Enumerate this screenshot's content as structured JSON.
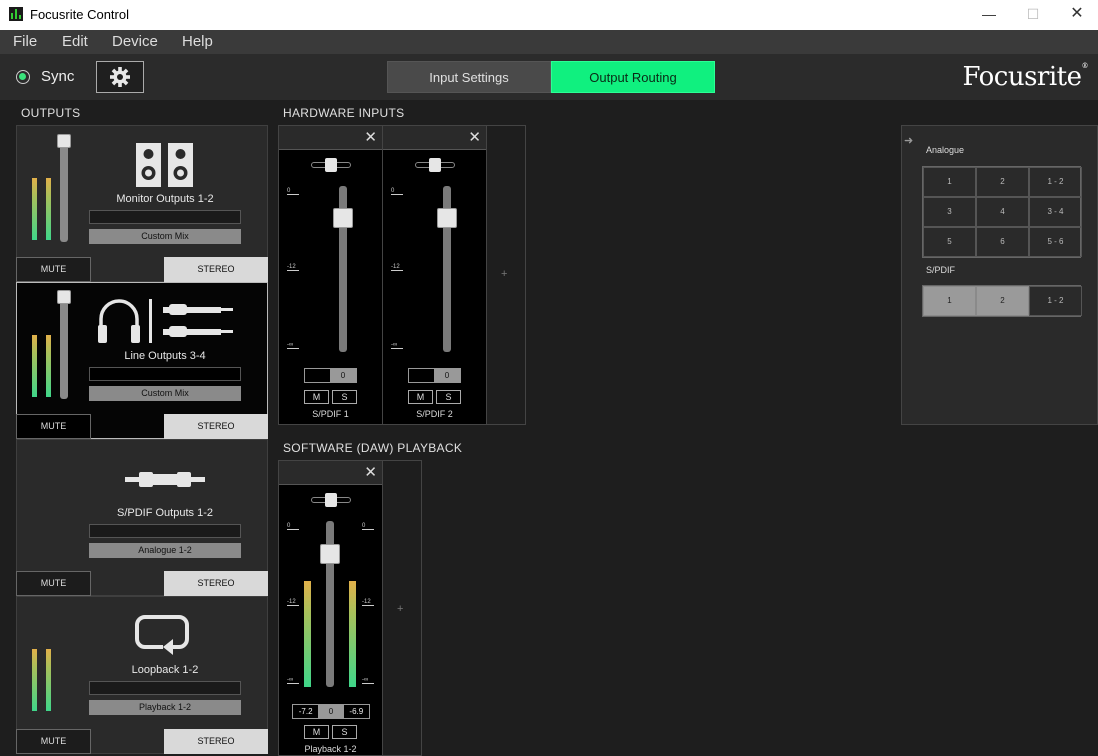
{
  "window": {
    "title": "Focusrite Control",
    "minimize": "—",
    "maximize": "☐",
    "close": "✕"
  },
  "menu": {
    "file": "File",
    "edit": "Edit",
    "device": "Device",
    "help": "Help"
  },
  "toolbar": {
    "sync_label": "Sync",
    "settings_icon": "gear-icon",
    "tab_input": "Input Settings",
    "tab_output": "Output Routing",
    "brand": "Focusrite",
    "brand_mark": "®"
  },
  "colors": {
    "accent": "#10f07f",
    "meter": "#3fd68a"
  },
  "outputs": {
    "title": "OUTPUTS",
    "cards": [
      {
        "name": "Monitor Outputs 1-2",
        "source": "Custom Mix",
        "mute": "MUTE",
        "stereo": "STEREO",
        "icon": "speakers-icon"
      },
      {
        "name": "Line Outputs 3-4",
        "source": "Custom Mix",
        "mute": "MUTE",
        "stereo": "STEREO",
        "icon": "headphones-icon"
      },
      {
        "name": "S/PDIF Outputs 1-2",
        "source": "Analogue 1-2",
        "mute": "MUTE",
        "stereo": "STEREO",
        "icon": "rca-cable-icon"
      },
      {
        "name": "Loopback 1-2",
        "source": "Playback 1-2",
        "mute": "MUTE",
        "stereo": "STEREO",
        "icon": "loopback-icon"
      }
    ]
  },
  "hardware_inputs": {
    "title": "HARDWARE INPUTS",
    "add": "+",
    "strips": [
      {
        "label": "S/PDIF 1",
        "gain": "0",
        "mute": "M",
        "solo": "S",
        "close": "✕",
        "scale_top": "0",
        "scale_mid": "-12",
        "scale_bot": "-∞"
      },
      {
        "label": "S/PDIF 2",
        "gain": "0",
        "mute": "M",
        "solo": "S",
        "close": "✕",
        "scale_top": "0",
        "scale_mid": "-12",
        "scale_bot": "-∞"
      }
    ]
  },
  "software_playback": {
    "title": "SOFTWARE (DAW) PLAYBACK",
    "add": "+",
    "strip": {
      "label": "Playback 1-2",
      "left": "-7.2",
      "gain": "0",
      "right": "-6.9",
      "mute": "M",
      "solo": "S",
      "close": "✕",
      "scale_top": "0",
      "scale_mid": "-12",
      "scale_bot": "-∞"
    }
  },
  "routing": {
    "analogue_label": "Analogue",
    "analogue": [
      "1",
      "2",
      "1 - 2",
      "3",
      "4",
      "3 - 4",
      "5",
      "6",
      "5 - 6"
    ],
    "spdif_label": "S/PDIF",
    "spdif": [
      "1",
      "2",
      "1 - 2"
    ]
  }
}
